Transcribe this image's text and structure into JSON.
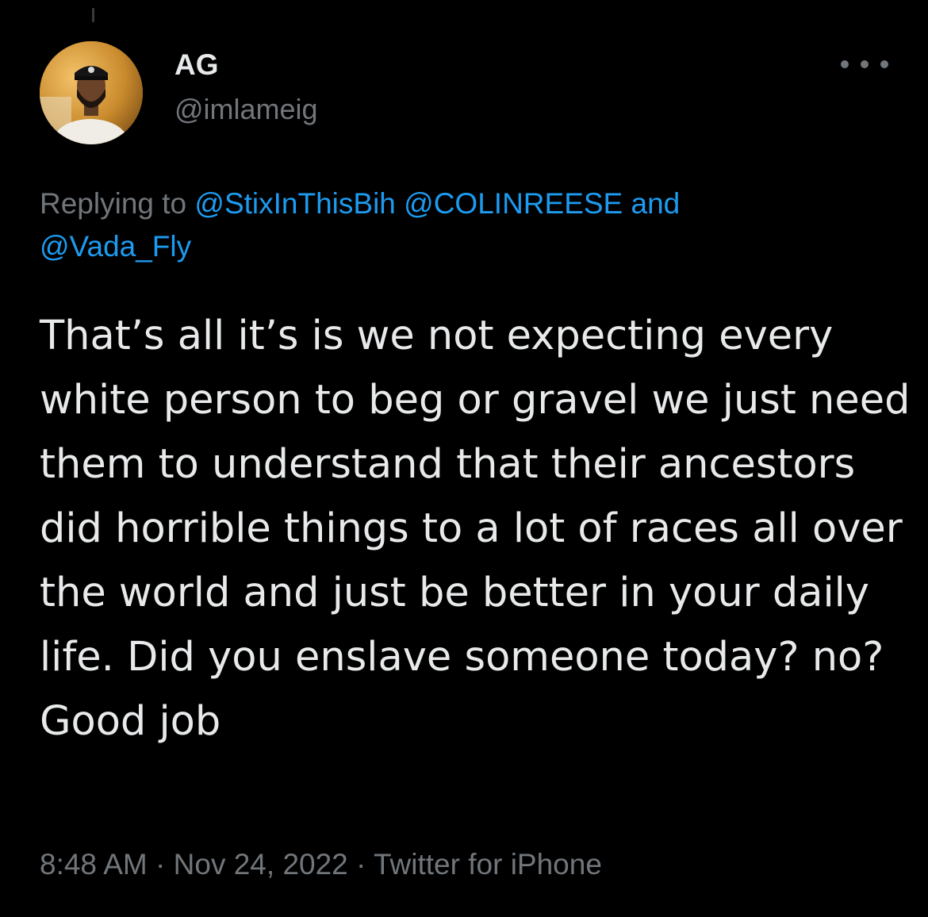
{
  "author": {
    "display_name": "AG",
    "handle": "@imlameig"
  },
  "reply": {
    "prefix": "Replying to",
    "mentions": [
      "@StixInThisBih",
      "@COLINREESE",
      "@Vada_Fly"
    ],
    "conjunction": "and"
  },
  "tweet": {
    "text": "That’s all it’s is we not expecting every white person to beg or gravel we just need them to understand that their ancestors did horrible things to a lot of races all over the world and just be better in your daily life. Did you enslave someone today? no? Good job"
  },
  "meta": {
    "time": "8:48 AM",
    "separator": "·",
    "date": "Nov 24, 2022",
    "source": "Twitter for iPhone"
  },
  "icons": {
    "more": "more-horizontal-icon",
    "avatar": "profile-photo"
  },
  "colors": {
    "background": "#000000",
    "text": "#E7E9EA",
    "secondary": "#71767B",
    "link": "#1D9BF0"
  }
}
